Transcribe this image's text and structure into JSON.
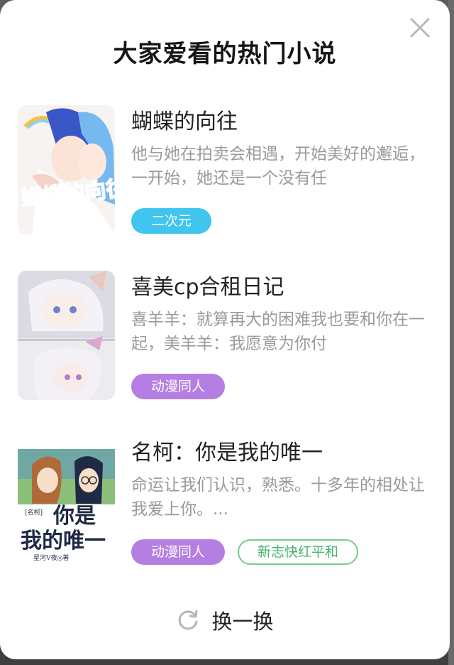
{
  "modal": {
    "title": "大家爱看的热门小说",
    "refresh_label": "换一换"
  },
  "books": [
    {
      "title": "蝴蝶的向往",
      "description": "他与她在拍卖会相遇，开始美好的邂逅，一开始，她还是一个没有任",
      "tags": [
        "二次元"
      ],
      "cover_text": "蝴蝶的向往"
    },
    {
      "title": "喜美cp合租日记",
      "description": "喜羊羊：就算再大的困难我也要和你在一起，美羊羊：我愿意为你付",
      "tags": [
        "动漫同人"
      ]
    },
    {
      "title": "名柯：你是我的唯一",
      "description": "命运让我们认识，熟悉。十多年的相处让我爱上你。...",
      "tags": [
        "动漫同人",
        "新志快红平和"
      ],
      "cover_text_1": "你是",
      "cover_text_2": "我的唯一",
      "cover_small": "[名柯]",
      "cover_author": "星河V夜◎著"
    }
  ],
  "colors": {
    "tag_blue": "#3fc5ee",
    "tag_purple": "#b57ee2",
    "tag_outline_green": "#45b46e"
  },
  "icons": {
    "close": "close-icon",
    "refresh": "refresh-icon"
  }
}
